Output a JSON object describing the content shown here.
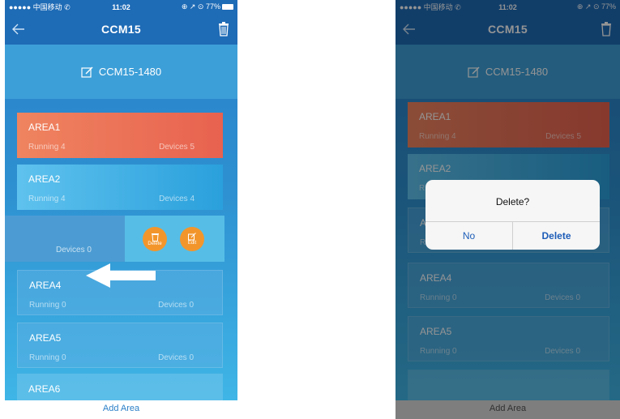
{
  "status": {
    "carrier": "●●●●● 中国移动 ✆",
    "time": "11:02",
    "right": "⊕ ↗ ⊙ 77%"
  },
  "nav": {
    "title": "CCM15"
  },
  "device_name": "CCM15-1480",
  "left_cards": [
    {
      "name": "AREA1",
      "running": "Running 4",
      "devices": "Devices 5"
    },
    {
      "name": "AREA2",
      "running": "Running 4",
      "devices": "Devices 4"
    },
    {
      "name": "AREA4",
      "running": "Running 0",
      "devices": "Devices 0"
    },
    {
      "name": "AREA5",
      "running": "Running 0",
      "devices": "Devices 0"
    }
  ],
  "swiped": {
    "devices": "Devices 0",
    "delete_label": "Delete",
    "edit_label": "Edit"
  },
  "peek": "AREA6",
  "right_cards": [
    {
      "name": "AREA1",
      "running": "Running 4",
      "devices": "Devices 5"
    },
    {
      "name": "AREA2",
      "running": "R"
    },
    {
      "name": "A",
      "running": "R"
    },
    {
      "name": "AREA4",
      "running": "Running 0",
      "devices": "Devices 0"
    },
    {
      "name": "AREA5",
      "running": "Running 0",
      "devices": "Devices 0"
    }
  ],
  "dialog": {
    "message": "Delete?",
    "no": "No",
    "delete": "Delete"
  },
  "footer": {
    "add_area": "Add Area"
  },
  "colors": {
    "nav": "#1e6bb6",
    "accent_orange": "#f2962c",
    "area1_red": "#e8624f",
    "area2_blue": "#2aa0dc",
    "link_blue": "#2a7fc8"
  }
}
